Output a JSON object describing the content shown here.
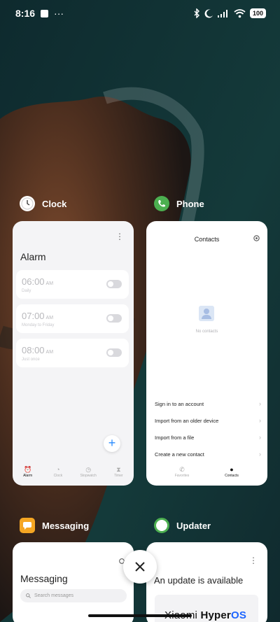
{
  "status_bar": {
    "time": "8:16",
    "dots": "···",
    "battery": "100"
  },
  "apps": {
    "clock": {
      "name": "Clock",
      "icon": "clock-icon",
      "title": "Alarm",
      "alarms": [
        {
          "time": "06:00",
          "ampm": "AM",
          "sub": "Daily"
        },
        {
          "time": "07:00",
          "ampm": "AM",
          "sub": "Monday to Friday"
        },
        {
          "time": "08:00",
          "ampm": "AM",
          "sub": "Just once"
        }
      ],
      "nav": [
        {
          "label": "Alarm",
          "icon": "alarm-icon"
        },
        {
          "label": "Clock",
          "icon": "clock-icon"
        },
        {
          "label": "Stopwatch",
          "icon": "stopwatch-icon"
        },
        {
          "label": "Timer",
          "icon": "timer-icon"
        }
      ],
      "fab": "+"
    },
    "phone": {
      "name": "Phone",
      "icon": "phone-icon",
      "title": "Contacts",
      "empty_text": "No contacts",
      "actions": [
        "Sign in to an account",
        "Import from an older device",
        "Import from a file",
        "Create a new contact"
      ],
      "nav": [
        {
          "label": "Favorites",
          "icon": "phone-icon"
        },
        {
          "label": "Contacts",
          "icon": "person-icon"
        }
      ]
    },
    "messaging": {
      "name": "Messaging",
      "icon": "message-icon",
      "title": "Messaging",
      "search_placeholder": "Search messages"
    },
    "updater": {
      "name": "Updater",
      "icon": "updater-icon",
      "title": "An update is available",
      "brand": "Xiaomi",
      "product": "Hyper",
      "suffix": "OS"
    }
  },
  "colors": {
    "accent_blue": "#2a8cff",
    "phone_green": "#4caf50",
    "hyperos_blue": "#1e66ff"
  }
}
